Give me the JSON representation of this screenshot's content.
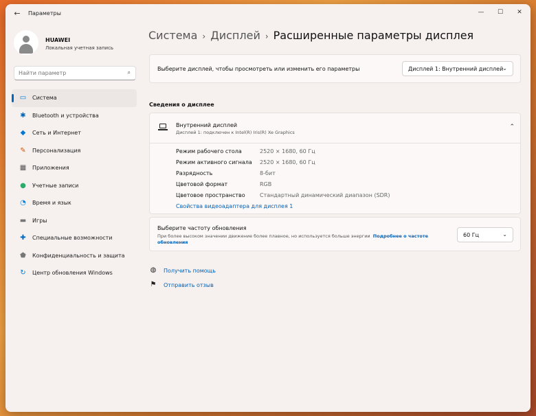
{
  "window": {
    "app_title": "Параметры",
    "back_glyph": "←",
    "controls": {
      "minimize": "—",
      "maximize": "☐",
      "close": "✕"
    }
  },
  "profile": {
    "name": "HUAWEI",
    "account_type": "Локальная учетная запись"
  },
  "search": {
    "placeholder": "Найти параметр",
    "icon": "search-icon"
  },
  "sidebar": {
    "items": [
      {
        "label": "Система",
        "icon": "system-icon",
        "glyph": "▭",
        "color": "#0078d4",
        "active": true
      },
      {
        "label": "Bluetooth и устройства",
        "icon": "bluetooth-icon",
        "glyph": "✱",
        "color": "#0067c0",
        "active": false
      },
      {
        "label": "Сеть и Интернет",
        "icon": "wifi-icon",
        "glyph": "◆",
        "color": "#0078d4",
        "active": false
      },
      {
        "label": "Персонализация",
        "icon": "brush-icon",
        "glyph": "✎",
        "color": "#d35400",
        "active": false
      },
      {
        "label": "Приложения",
        "icon": "apps-icon",
        "glyph": "▦",
        "color": "#555555",
        "active": false
      },
      {
        "label": "Учетные записи",
        "icon": "accounts-icon",
        "glyph": "●",
        "color": "#2eaa6b",
        "active": false
      },
      {
        "label": "Время и язык",
        "icon": "time-language-icon",
        "glyph": "◔",
        "color": "#0078d4",
        "active": false
      },
      {
        "label": "Игры",
        "icon": "gamepad-icon",
        "glyph": "▬",
        "color": "#777777",
        "active": false
      },
      {
        "label": "Специальные возможности",
        "icon": "accessibility-icon",
        "glyph": "✚",
        "color": "#0067c0",
        "active": false
      },
      {
        "label": "Конфиденциальность и защита",
        "icon": "shield-icon",
        "glyph": "⬟",
        "color": "#777777",
        "active": false
      },
      {
        "label": "Центр обновления Windows",
        "icon": "update-icon",
        "glyph": "↻",
        "color": "#0078d4",
        "active": false
      }
    ]
  },
  "breadcrumb": {
    "part1": "Система",
    "part2": "Дисплей",
    "current": "Расширенные параметры дисплея",
    "separator": "›"
  },
  "display_select": {
    "label": "Выберите дисплей, чтобы просмотреть или изменить его параметры",
    "value": "Дисплей 1: Внутренний дисплей"
  },
  "display_info": {
    "section_title": "Сведения о дисплее",
    "title": "Внутренний дисплей",
    "subtitle": "Дисплей 1: подключен к Intel(R) Iris(R) Xe Graphics",
    "rows": [
      {
        "key": "Режим рабочего стола",
        "value": "2520 × 1680, 60 Гц"
      },
      {
        "key": "Режим активного сигнала",
        "value": "2520 × 1680, 60 Гц"
      },
      {
        "key": "Разрядность",
        "value": "8-бит"
      },
      {
        "key": "Цветовой формат",
        "value": "RGB"
      },
      {
        "key": "Цветовое пространство",
        "value": "Стандартный динамический диапазон (SDR)"
      }
    ],
    "adapter_link": "Свойства видеоадаптера для дисплея 1"
  },
  "refresh_rate": {
    "title": "Выберите частоту обновления",
    "description": "При более высоком значении движение более плавное, но используется больше энергии",
    "more_link": "Подробнее о частоте обновления",
    "value": "60 Гц"
  },
  "help": {
    "get_help": "Получить помощь",
    "feedback": "Отправить отзыв"
  },
  "colors": {
    "accent": "#0067c0",
    "link": "#0060b8",
    "window_bg": "#f6f1ef",
    "card_bg": "#fbf8f7"
  }
}
